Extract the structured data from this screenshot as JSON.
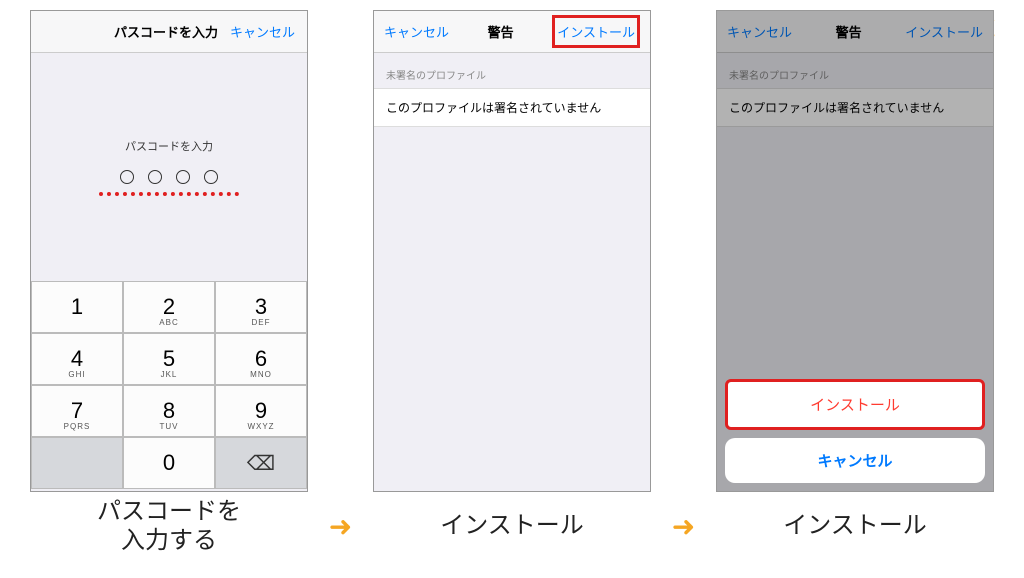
{
  "screen1": {
    "header_title": "パスコードを入力",
    "header_cancel": "キャンセル",
    "prompt": "パスコードを入力",
    "keypad": {
      "k1": "1",
      "k2": "2",
      "k2l": "ABC",
      "k3": "3",
      "k3l": "DEF",
      "k4": "4",
      "k4l": "GHI",
      "k5": "5",
      "k5l": "JKL",
      "k6": "6",
      "k6l": "MNO",
      "k7": "7",
      "k7l": "PQRS",
      "k8": "8",
      "k8l": "TUV",
      "k9": "9",
      "k9l": "WXYZ",
      "k0": "0"
    }
  },
  "screen2": {
    "header_left": "キャンセル",
    "header_center": "警告",
    "header_right": "インストール",
    "section_label": "未署名のプロファイル",
    "row_text": "このプロファイルは署名されていません"
  },
  "screen3": {
    "header_left": "キャンセル",
    "header_center": "警告",
    "header_right": "インストール",
    "section_label": "未署名のプロファイル",
    "row_text": "このプロファイルは署名されていません",
    "sheet_install": "インストール",
    "sheet_cancel": "キャンセル"
  },
  "captions": {
    "c1a": "パスコードを",
    "c1b": "入力する",
    "c2": "インストール",
    "c3": "インストール"
  },
  "glyphs": {
    "arrow": "➜",
    "backspace": "⌫"
  }
}
